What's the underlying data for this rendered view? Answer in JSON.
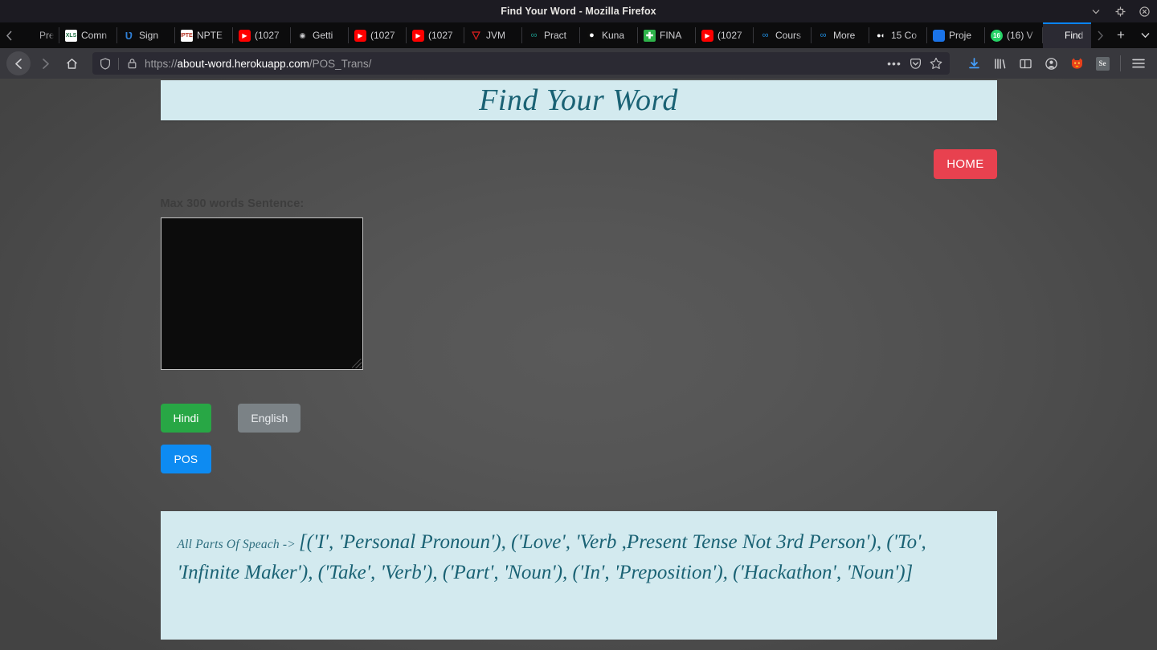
{
  "window": {
    "title": "Find Your Word - Mozilla Firefox",
    "controls": {
      "minimize": "minimize-label",
      "restore": "restore-label",
      "close": "close-label"
    }
  },
  "tabbar": {
    "scroll_left": "‹",
    "scroll_right": "›",
    "new_tab": "+",
    "list_all": "∨",
    "tabs": [
      {
        "label": "Pre-P",
        "icon": "blank-favicon",
        "icon_class": "fav-fyw",
        "glyph": "",
        "active": false,
        "partial": true
      },
      {
        "label": "Comn",
        "icon": "spreadsheet-favicon",
        "icon_class": "fav-xls",
        "glyph": "XLS",
        "active": false,
        "partial": false
      },
      {
        "label": "Sign ",
        "icon": "unstop-favicon",
        "icon_class": "fav-u",
        "glyph": "Ʋ",
        "active": false,
        "partial": false
      },
      {
        "label": "NPTE",
        "icon": "nptel-favicon",
        "icon_class": "fav-npt",
        "glyph": "NPTEL",
        "active": false,
        "partial": false
      },
      {
        "label": "(1027",
        "icon": "youtube-favicon",
        "icon_class": "fav-yt",
        "glyph": "▶",
        "active": false,
        "partial": false
      },
      {
        "label": "Getti",
        "icon": "circle-favicon",
        "icon_class": "fav-circ",
        "glyph": "◉",
        "active": false,
        "partial": false
      },
      {
        "label": "(1027",
        "icon": "youtube-favicon",
        "icon_class": "fav-yt",
        "glyph": "▶",
        "active": false,
        "partial": false
      },
      {
        "label": "(1027",
        "icon": "youtube-favicon",
        "icon_class": "fav-yt",
        "glyph": "▶",
        "active": false,
        "partial": false
      },
      {
        "label": "JVM ",
        "icon": "jvm-favicon",
        "icon_class": "fav-jvm",
        "glyph": "▽",
        "active": false,
        "partial": false
      },
      {
        "label": "Pract",
        "icon": "infinity-favicon",
        "icon_class": "fav-inf",
        "glyph": "∞",
        "active": false,
        "partial": false
      },
      {
        "label": "Kuna",
        "icon": "github-favicon",
        "icon_class": "fav-gh",
        "glyph": "●",
        "active": false,
        "partial": false
      },
      {
        "label": "FINA",
        "icon": "plus-green-favicon",
        "icon_class": "fav-fin",
        "glyph": "✚",
        "active": false,
        "partial": false
      },
      {
        "label": "(1027",
        "icon": "youtube-favicon",
        "icon_class": "fav-yt",
        "glyph": "▶",
        "active": false,
        "partial": false
      },
      {
        "label": "Cours",
        "icon": "coursera-favicon",
        "icon_class": "fav-inf2",
        "glyph": "∞",
        "active": false,
        "partial": false
      },
      {
        "label": "More",
        "icon": "coursera-favicon",
        "icon_class": "fav-inf2",
        "glyph": "∞",
        "active": false,
        "partial": false
      },
      {
        "label": "15 Co",
        "icon": "dots-favicon",
        "icon_class": "fav-dots",
        "glyph": "●◐",
        "active": false,
        "partial": false
      },
      {
        "label": "Proje",
        "icon": "blue-doc-favicon",
        "icon_class": "fav-blue",
        "glyph": "",
        "active": false,
        "partial": false
      },
      {
        "label": "(16) V",
        "icon": "whatsapp-favicon",
        "icon_class": "fav-wa",
        "glyph": "16",
        "active": false,
        "partial": false
      },
      {
        "label": "Find Y",
        "icon": "find-your-word-favicon",
        "icon_class": "fav-fyw",
        "glyph": "",
        "active": true,
        "partial": false
      }
    ],
    "close_glyph": "✕"
  },
  "navbar": {
    "back": "back-label",
    "forward": "forward-label",
    "home": "home-label",
    "url": {
      "scheme": "https://",
      "host": "about-word.herokuapp.com",
      "path": "/POS_Trans/",
      "full": "https://about-word.herokuapp.com/POS_Trans/"
    },
    "page_actions_glyph": "•••",
    "pocket": "pocket-label",
    "bookmark_glyph": "☆",
    "toolbar_icons": [
      "downloads-icon",
      "library-icon",
      "sidebar-icon",
      "account-icon",
      "extension-icon",
      "selenium-ide-icon",
      "menu-icon"
    ],
    "selenium_label": "Se"
  },
  "page": {
    "banner_title": "Find Your Word",
    "home_button": "HOME",
    "form_label": "Max 300 words Sentence:",
    "textarea_value": "",
    "textarea_placeholder": "",
    "buttons": {
      "hindi": "Hindi",
      "english": "English",
      "pos": "POS"
    },
    "result": {
      "key": "All Parts Of Speach ->",
      "value": "[('I', 'Personal Pronoun'), ('Love', 'Verb ,Present Tense Not 3rd Person'), ('To', 'Infinite Maker'), ('Take', 'Verb'), ('Part', 'Noun'), ('In', 'Preposition'), ('Hackathon', 'Noun')]"
    }
  },
  "colors": {
    "banner_bg": "#d3eaef",
    "banner_text": "#1a6274",
    "home_button": "#e8414f",
    "hindi_button": "#28a745",
    "english_button": "#7b8286",
    "pos_button": "#0d8bf2",
    "page_bg": "#525252",
    "active_tab_accent": "#0a84ff"
  }
}
